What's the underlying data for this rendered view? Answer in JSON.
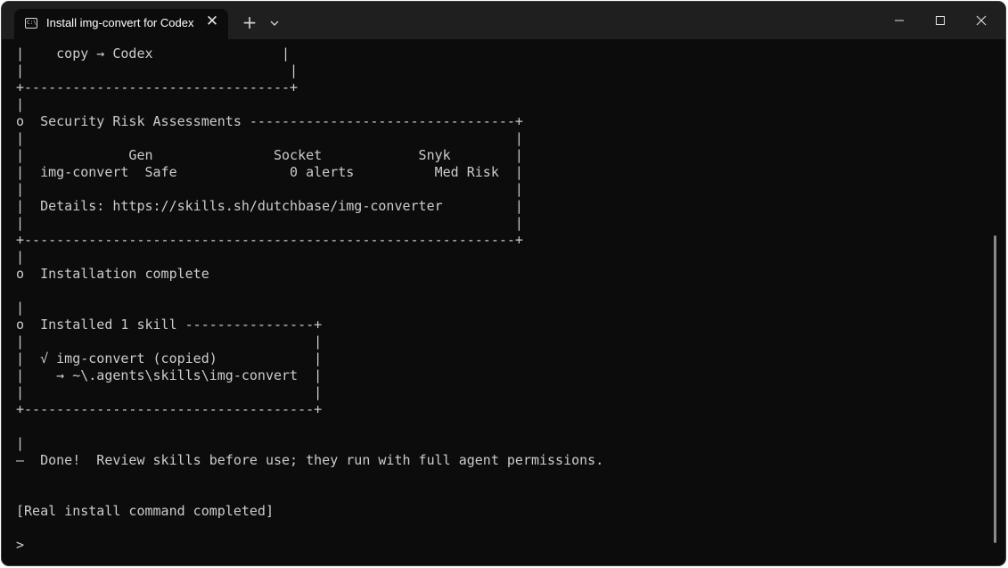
{
  "window": {
    "tab_title": "Install img-convert for Codex",
    "tab_icon_glyph": "C:\\",
    "close_tab_glyph": "✕",
    "new_tab_glyph": "+"
  },
  "icons": {
    "tab": "terminal-icon",
    "close": "close-icon",
    "new_tab": "plus-icon",
    "dropdown": "chevron-down-icon",
    "minimize": "minimize-icon",
    "maximize": "maximize-icon",
    "window_close": "close-icon"
  },
  "colors": {
    "terminal_bg": "#0c0c0c",
    "titlebar_bg": "#1f1f1f",
    "text": "#cccccc"
  },
  "terminal": {
    "lines": [
      "|    copy → Codex                |",
      "|                                 |",
      "+---------------------------------+",
      "|",
      "o  Security Risk Assessments ---------------------------------+",
      "|                                                             |",
      "|             Gen               Socket            Snyk        |",
      "|  img-convert  Safe              0 alerts          Med Risk  |",
      "|                                                             |",
      "|  Details: https://skills.sh/dutchbase/img-converter         |",
      "|                                                             |",
      "+-------------------------------------------------------------+",
      "|",
      "o  Installation complete",
      "",
      "|",
      "o  Installed 1 skill ----------------+",
      "|                                    |",
      "|  √ img-convert (copied)            |",
      "|    → ~\\.agents\\skills\\img-convert  |",
      "|                                    |",
      "+------------------------------------+",
      "",
      "|",
      "—  Done!  Review skills before use; they run with full agent permissions.",
      "",
      "",
      "[Real install command completed]",
      "",
      ">"
    ]
  }
}
